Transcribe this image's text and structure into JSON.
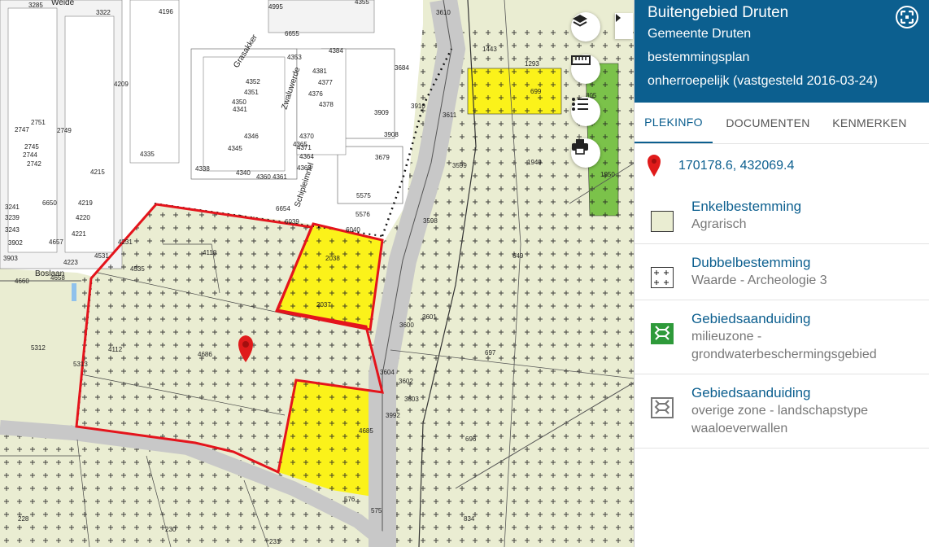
{
  "map": {
    "parcel_labels": [
      "3285",
      "3322",
      "4196",
      "4995",
      "4355",
      "3610",
      "1443",
      "1293",
      "699",
      "805",
      "6655",
      "4353",
      "4384",
      "4341",
      "3910",
      "3611",
      "3684",
      "3909",
      "3908",
      "3679",
      "3599",
      "1949",
      "1950",
      "5575",
      "5576",
      "3598",
      "6654",
      "6039",
      "6040",
      "2038",
      "2037",
      "4110",
      "4535",
      "4112",
      "4686",
      "3600",
      "3601",
      "3602",
      "3603",
      "3604",
      "3992",
      "649",
      "697",
      "696",
      "4685",
      "576",
      "575",
      "834",
      "230",
      "231",
      "228",
      "5312",
      "5313",
      "4660",
      "4658",
      "4221",
      "4223",
      "4220",
      "4219",
      "4215",
      "4209",
      "4335",
      "4338",
      "4340",
      "4345",
      "4346",
      "4350",
      "4351",
      "4352",
      "4360",
      "4361",
      "4363",
      "4364",
      "4365",
      "4370",
      "4371",
      "4376",
      "4377",
      "4378",
      "4381",
      "3241",
      "3239",
      "3243",
      "3902",
      "3903",
      "2751",
      "2749",
      "2747",
      "2745",
      "2744",
      "2742",
      "6650",
      "4657",
      "4531",
      "4231"
    ],
    "street_labels": [
      "Boslaan",
      "Schipleimnel",
      "Grasakker",
      "Zwaluwerde",
      "Weide"
    ],
    "colors": {
      "base": "#eaedd2",
      "yellow": "#fbf21a",
      "green": "#7bc24a",
      "red_outline": "#e4141c",
      "road": "#c8c8c8",
      "water": "#8fc1ec"
    }
  },
  "controls": {
    "layers_icon": "layers-icon",
    "measure_icon": "ruler-icon",
    "legend_icon": "list-icon",
    "print_icon": "printer-icon",
    "collapse_icon": "chevron-right-icon"
  },
  "panel": {
    "title": "Buitengebied Druten",
    "subtitles": [
      "Gemeente Druten",
      "bestemmingsplan",
      "onherroepelijk (vastgesteld 2016-03-24)"
    ],
    "tabs": [
      "PLEKINFO",
      "DOCUMENTEN",
      "KENMERKEN"
    ],
    "coordinates": "170178.6, 432069.4",
    "items": [
      {
        "title": "Enkelbestemming",
        "sub": "Agrarisch",
        "swatch": "agrarisch"
      },
      {
        "title": "Dubbelbestemming",
        "sub": "Waarde - Archeologie 3",
        "swatch": "archeologie"
      },
      {
        "title": "Gebiedsaanduiding",
        "sub": "milieuzone - grondwaterbeschermingsgebied",
        "swatch": "milieuzone"
      },
      {
        "title": "Gebiedsaanduiding",
        "sub": "overige zone - landschapstype waaloeverwallen",
        "swatch": "overige"
      }
    ]
  }
}
